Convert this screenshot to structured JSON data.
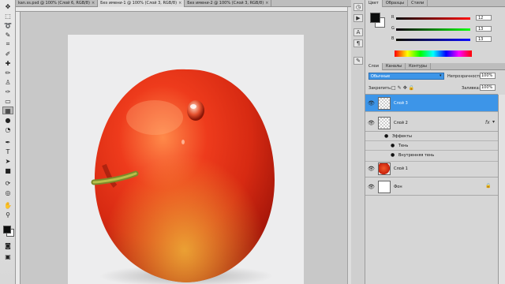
{
  "doc_tabs": [
    {
      "label": "kan.ss.psd @ 100% (Слой 6, RGB/8)",
      "active": false
    },
    {
      "label": "Без имени-1 @ 100% (Слой 3, RGB/8)",
      "active": true
    },
    {
      "label": "Без имени-2 @ 100% (Слой 3, RGB/8)",
      "active": false
    }
  ],
  "tools": [
    "move-tool",
    "marquee-tool",
    "lasso-tool",
    "quick-select-tool",
    "crop-tool",
    "eyedropper-tool",
    "healing-tool",
    "brush-tool",
    "clone-stamp-tool",
    "history-brush-tool",
    "eraser-tool",
    "gradient-tool",
    "blur-tool",
    "dodge-tool",
    "pen-tool",
    "type-tool",
    "path-select-tool",
    "shape-tool",
    "3d-rotate-tool",
    "3d-orbit-tool",
    "hand-tool",
    "zoom-tool"
  ],
  "color_panel": {
    "tabs": [
      "Цвет",
      "Образцы",
      "Стили"
    ],
    "channels": [
      {
        "label": "R",
        "value": "12"
      },
      {
        "label": "G",
        "value": "13"
      },
      {
        "label": "B",
        "value": "13"
      }
    ],
    "foreground": "#0c0d0d",
    "background": "#ffffff"
  },
  "layers_panel": {
    "tabs": [
      "Слои",
      "Каналы",
      "Контуры"
    ],
    "blend_mode": "Обычные",
    "opacity_label": "Непрозрачность:",
    "opacity_value": "100%",
    "lock_label": "Закрепить:",
    "fill_label": "Заливка:",
    "fill_value": "100%",
    "layers": [
      {
        "name": "Слой 3",
        "selected": true
      },
      {
        "name": "Слой 2",
        "fx": "fx"
      },
      {
        "name": "Слой 1"
      },
      {
        "name": "Фон"
      }
    ],
    "effects_label": "Эффекты",
    "effects": [
      "Тень",
      "Внутренняя тень"
    ]
  }
}
